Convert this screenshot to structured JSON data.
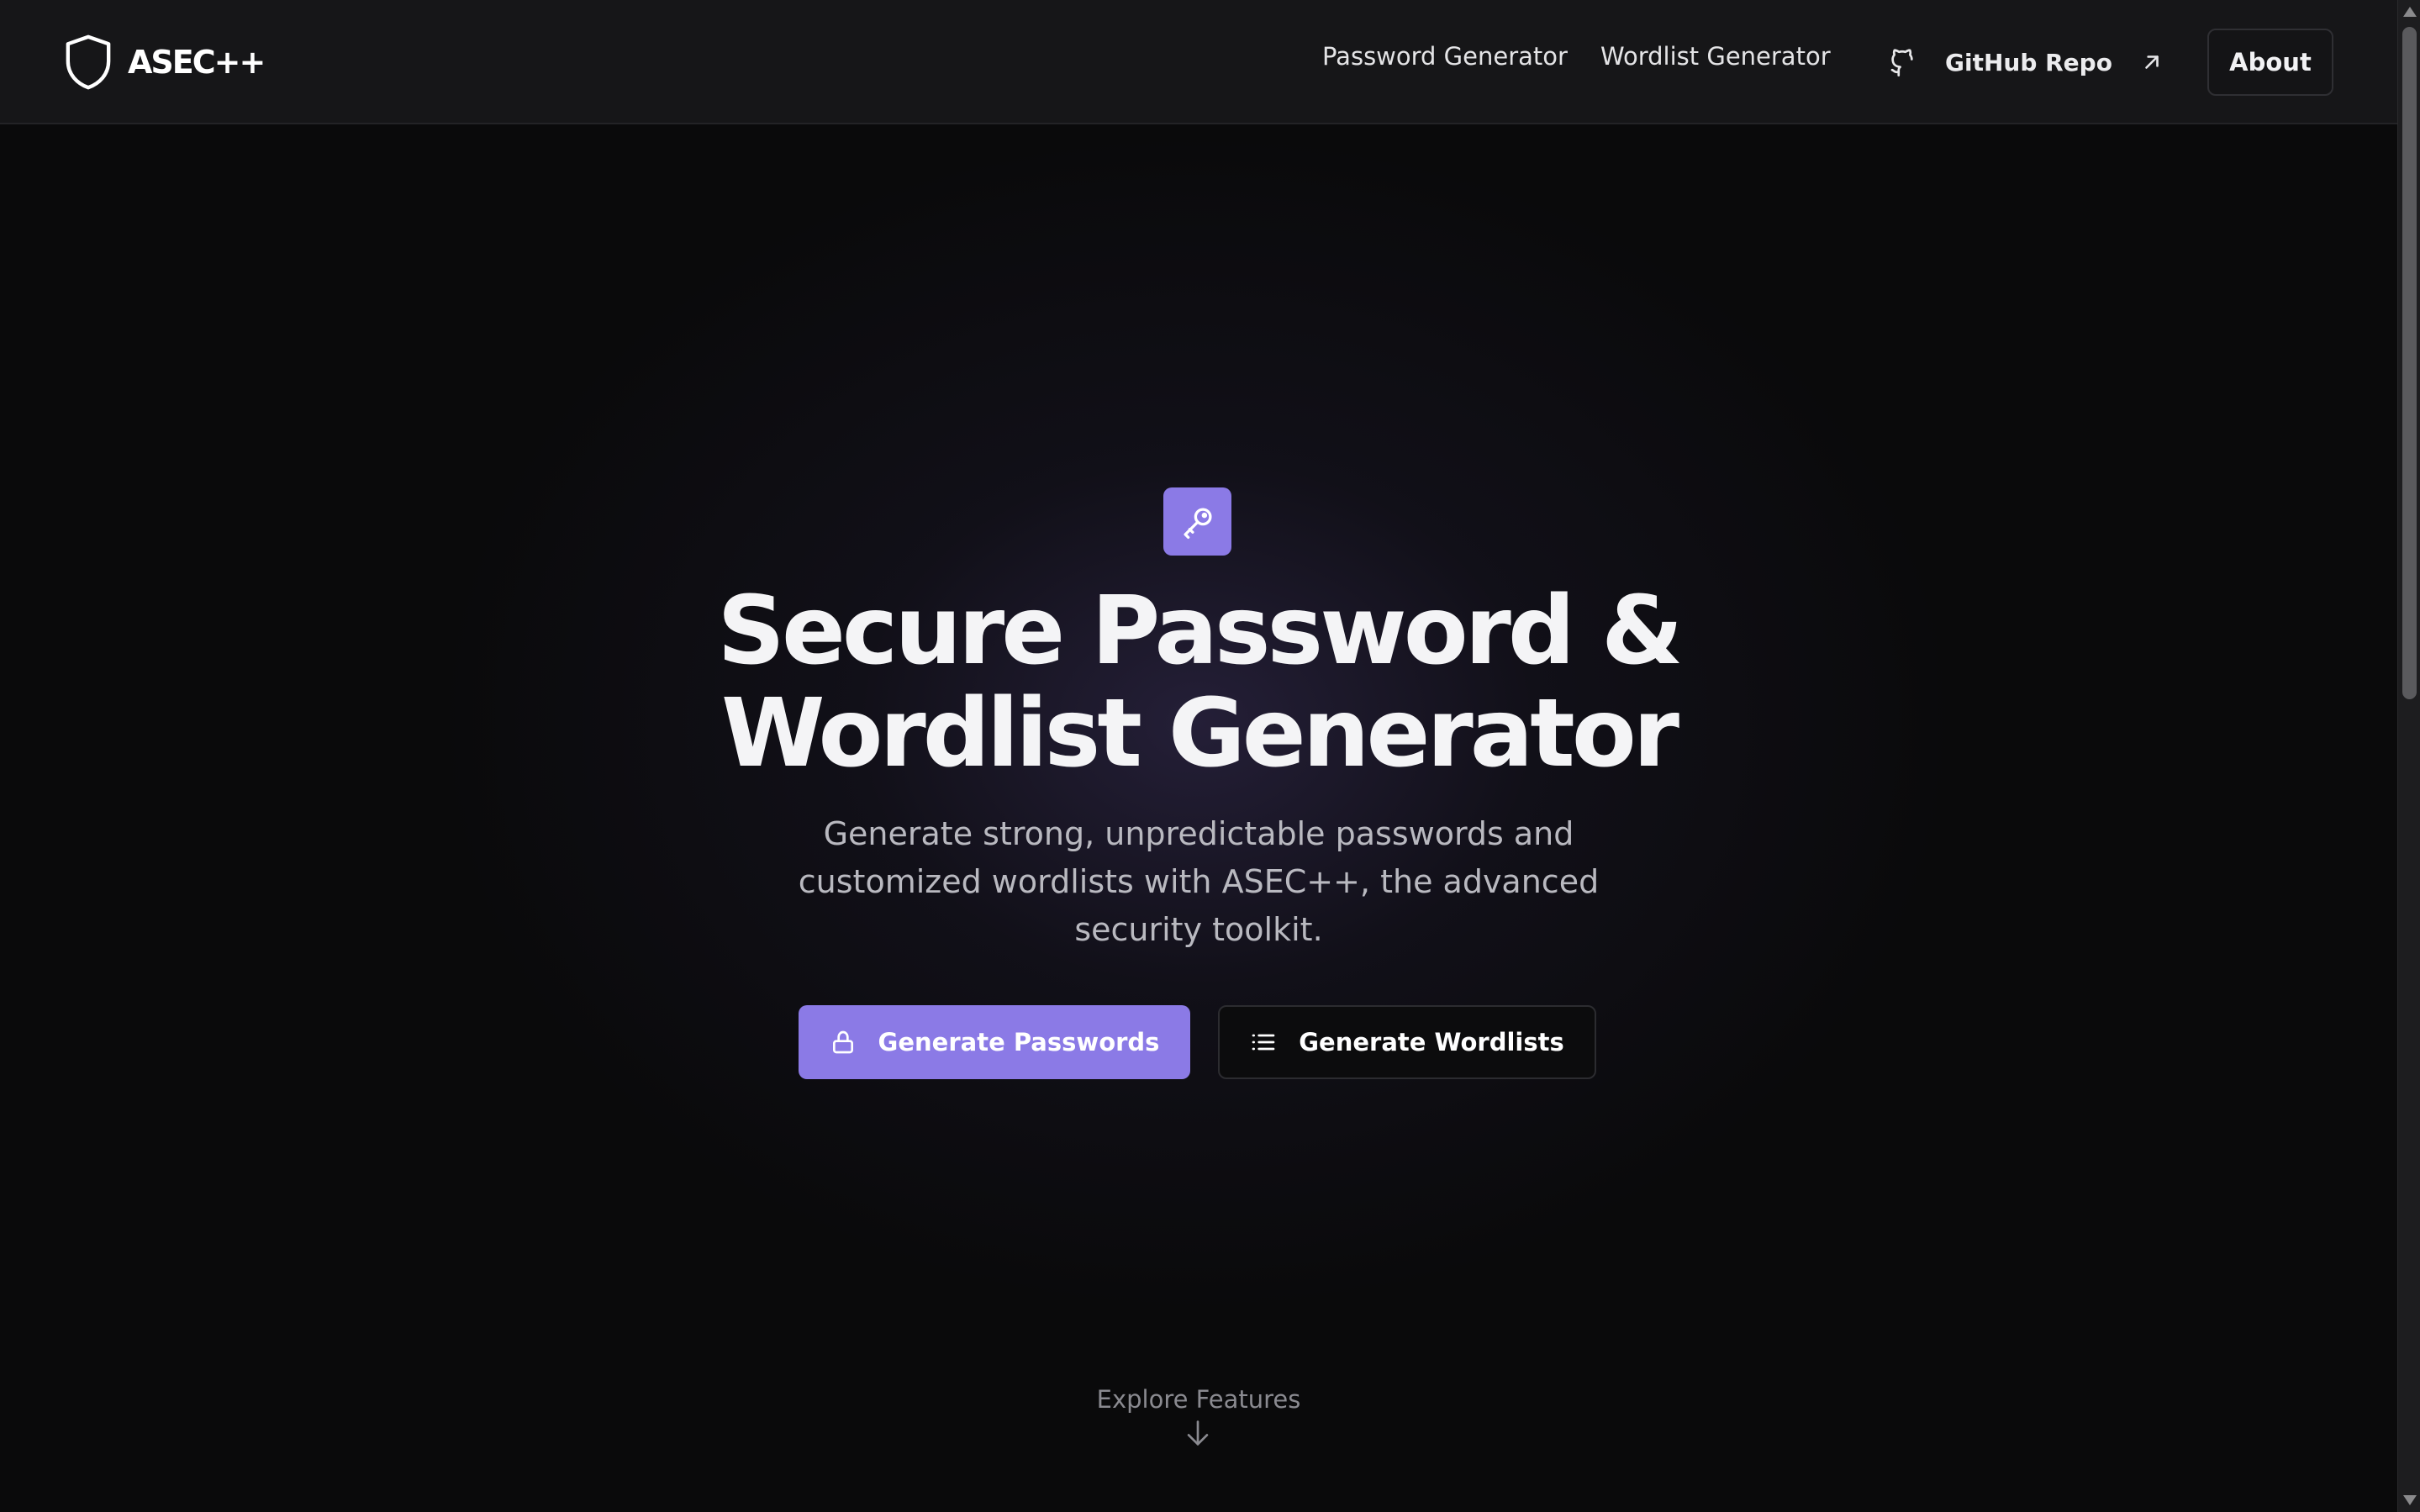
{
  "header": {
    "brand": "ASEC++",
    "brand_icon": "shield-icon",
    "nav": [
      {
        "label": "Password Generator"
      },
      {
        "label": "Wordlist Generator"
      }
    ],
    "github": {
      "label": "GitHub Repo",
      "icon": "github-icon",
      "trailing_icon": "external-link-icon"
    },
    "about_label": "About"
  },
  "hero": {
    "icon": "key-icon",
    "title": "Secure Password &\nWordlist Generator",
    "subtitle": "Generate strong, unpredictable passwords and customized wordlists with ASEC++, the advanced security toolkit.",
    "primary_button": {
      "label": "Generate Passwords",
      "icon": "lock-icon"
    },
    "secondary_button": {
      "label": "Generate Wordlists",
      "icon": "list-icon"
    },
    "explore_label": "Explore Features",
    "explore_icon": "arrow-down-icon"
  },
  "colors": {
    "accent": "#8b7ae6",
    "background": "#0a0a0b",
    "header_bg": "#161618"
  }
}
